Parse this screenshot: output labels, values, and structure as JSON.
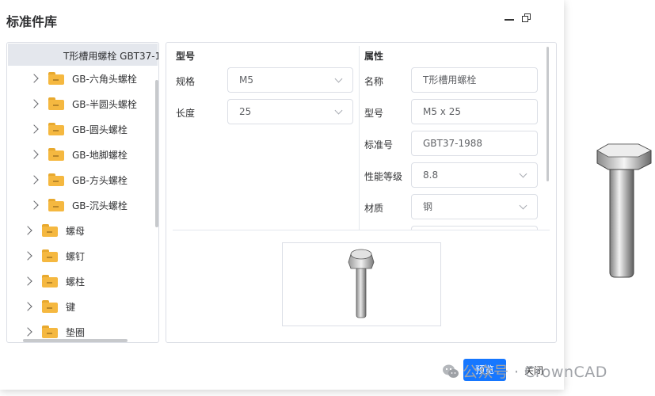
{
  "title": "标准件库",
  "window": {
    "minimize_icon": "minimize-icon",
    "restore_icon": "restore-icon"
  },
  "tree": {
    "selected": "T形槽用螺栓 GBT37-1",
    "children": [
      {
        "label": "GB-六角头螺栓"
      },
      {
        "label": "GB-半圆头螺栓"
      },
      {
        "label": "GB-圆头螺栓"
      },
      {
        "label": "GB-地脚螺栓"
      },
      {
        "label": "GB-方头螺栓"
      },
      {
        "label": "GB-沉头螺栓"
      }
    ],
    "roots": [
      {
        "label": "螺母"
      },
      {
        "label": "螺钉"
      },
      {
        "label": "螺柱"
      },
      {
        "label": "键"
      },
      {
        "label": "垫圈"
      }
    ]
  },
  "model": {
    "section": "型号",
    "spec_label": "规格",
    "spec_value": "M5",
    "length_label": "长度",
    "length_value": "25"
  },
  "props": {
    "section": "属性",
    "name_label": "名称",
    "name_value": "T形槽用螺栓",
    "model_label": "型号",
    "model_value": "M5 x 25",
    "std_label": "标准号",
    "std_value": "GBT37-1988",
    "grade_label": "性能等级",
    "grade_value": "8.8",
    "material_label": "材质",
    "material_value": "钢"
  },
  "footer": {
    "preview": "预览",
    "close": "关闭"
  },
  "watermark": "公众号 · CrownCAD",
  "colors": {
    "primary": "#1677ff",
    "folder": "#f5b840",
    "selected_bg": "#e4e7ed"
  }
}
